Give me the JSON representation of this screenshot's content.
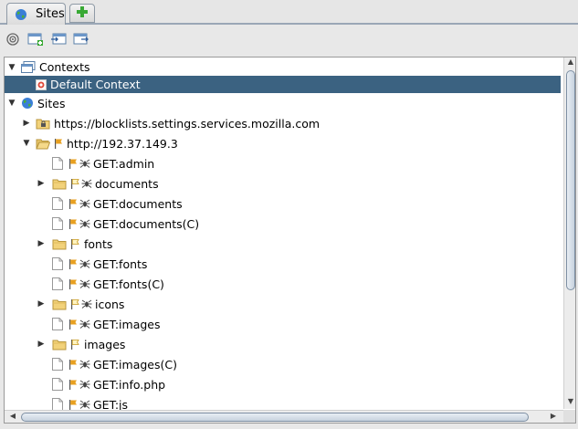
{
  "tabs": {
    "sites_label": "Sites",
    "add_icon": "plus-icon"
  },
  "toolbar": {
    "buttons": [
      "target-icon",
      "new-context-icon",
      "import-context-icon",
      "export-context-icon"
    ]
  },
  "tree": {
    "contexts_label": "Contexts",
    "default_context_label": "Default Context",
    "sites_label": "Sites",
    "site1_label": "https://blocklists.settings.services.mozilla.com",
    "site2_label": "http://192.37.149.3",
    "nodes": [
      {
        "label": "GET:admin"
      },
      {
        "label": "documents"
      },
      {
        "label": "GET:documents"
      },
      {
        "label": "GET:documents(C)"
      },
      {
        "label": "fonts"
      },
      {
        "label": "GET:fonts"
      },
      {
        "label": "GET:fonts(C)"
      },
      {
        "label": "icons"
      },
      {
        "label": "GET:images"
      },
      {
        "label": "images"
      },
      {
        "label": "GET:images(C)"
      },
      {
        "label": "GET:info.php"
      },
      {
        "label": "GET:js"
      }
    ]
  },
  "colors": {
    "selection": "#3b6281",
    "flag": "#e8a020",
    "folder": "#f2d27a"
  }
}
